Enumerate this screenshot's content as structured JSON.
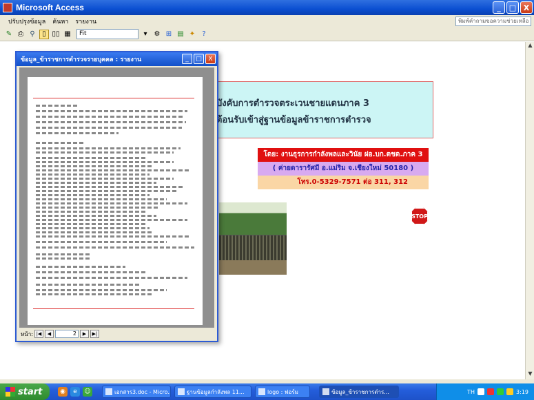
{
  "window": {
    "title": "Microsoft Access",
    "buttons": [
      "_",
      "□",
      "X"
    ]
  },
  "menubar": {
    "items": [
      "ปรับปรุงข้อมูล",
      "ค้นหา",
      "รายงาน"
    ],
    "help_placeholder": "พิมพ์คำถามขอความช่วยเหลือ"
  },
  "toolbar": {
    "zoom_value": "Fit",
    "icons": [
      "design-view-icon",
      "print-icon",
      "zoom-icon",
      "one-page-icon",
      "two-pages-icon",
      "multiple-pages-icon",
      "setup-icon",
      "office-links-icon",
      "database-window-icon",
      "new-object-icon",
      "help-icon"
    ]
  },
  "main": {
    "banner_line1": "บังคับการตำรวจตระเวนชายแดนภาค 3",
    "banner_line2": "ต้อนรับเข้าสู่ฐานข้อมูลข้าราชการตำรวจ",
    "credit_line1": "โดย: งานธุรการกำลังพลและวินัย ฝอ.บก.ตชด.ภาค 3",
    "credit_line2": "( ค่ายดารารัศมี  อ.แม่ริม  จ.เชียงใหม่  50180 )",
    "credit_line3": "โทร.0-5329-7571  ต่อ 311, 312",
    "stop_label": "STOP"
  },
  "report_window": {
    "title": "ข้อมูล_ข้าราชการตำรวจรายบุคคล : รายงาน",
    "page_label": "หน้า:",
    "page_value": "2"
  },
  "colors": {
    "banner_bg": "#ccf5f5",
    "credit_red": "#e01010",
    "credit_violet": "#d8aaf0",
    "credit_peach": "#fad6a5"
  },
  "taskbar": {
    "start_label": "start",
    "tasks": [
      "เอกสาร3.doc - Micro...",
      "ฐานข้อมูลกำลังพล 11...",
      "logo : ฟอร์ม",
      "ข้อมูล_ข้าราชการตำร..."
    ],
    "tray_lang": "TH",
    "clock": "3:19"
  }
}
